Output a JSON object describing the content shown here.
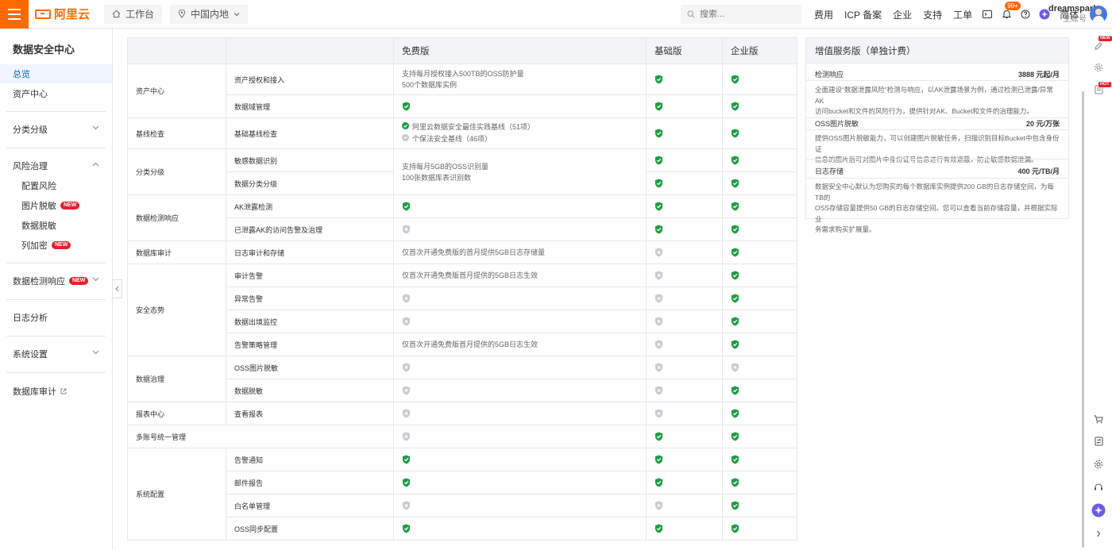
{
  "header": {
    "brand": "阿里云",
    "workbench": "工作台",
    "region": "中国内地",
    "search_placeholder": "搜索...",
    "nav": [
      "费用",
      "ICP 备案",
      "企业",
      "支持",
      "工单"
    ],
    "notification_badge": "99+",
    "lang": "简体",
    "user_name": "dreamspark",
    "user_role": "主账号"
  },
  "sidebar": {
    "title": "数据安全中心",
    "items": [
      {
        "label": "总览"
      },
      {
        "label": "资产中心"
      },
      {
        "label": "分类分级"
      },
      {
        "label": "风险治理"
      },
      {
        "label": "配置风险"
      },
      {
        "label": "图片脱敏",
        "tag": "NEW"
      },
      {
        "label": "数据脱敏"
      },
      {
        "label": "列加密",
        "tag": "NEW"
      },
      {
        "label": "数据检测响应",
        "tag": "NEW"
      },
      {
        "label": "日志分析"
      },
      {
        "label": "系统设置"
      },
      {
        "label": "数据库审计"
      }
    ]
  },
  "table": {
    "headers": [
      "",
      "",
      "免费版",
      "基础版",
      "企业版"
    ],
    "categories": [
      "资产中心",
      "基线检查",
      "分类分级",
      "数据检测响应",
      "数据库审计",
      "安全态势",
      "数据治理",
      "报表中心",
      "多账号统一管理",
      "系统配置"
    ],
    "features": [
      "资产授权和接入",
      "数据域管理",
      "基础基线检查",
      "敏感数据识别",
      "数据分类分级",
      "AK泄露检测",
      "已泄露AK的访问告警及治理",
      "日志审计和存储",
      "审计告警",
      "异常告警",
      "数据出境监控",
      "告警策略管理",
      "OSS图片脱敏",
      "数据脱敏",
      "查看报表",
      "告警通知",
      "邮件报告",
      "白名单管理",
      "OSS同步配置"
    ],
    "free_text": {
      "asset_1": "支持每月授权接入500TB的OSS防护量",
      "asset_2": "500个数据库实例",
      "baseline_1": "阿里云数据安全最佳实践基线（51项）",
      "baseline_2": "个保法安全基线（46项）",
      "classify_1": "支持每月5GB的OSS识别量",
      "classify_2": "100张数据库表识别数",
      "audit_log": "仅首次开通免费版的首月提供5GB日志存储量",
      "audit_alert": "仅首次开通免费版首月提供的5GB日志生效",
      "alert_policy": "仅首次开通免费版首月提供的5GB日志生效"
    }
  },
  "panel": {
    "title": "增值服务版（单独计费）",
    "items": [
      {
        "name": "检测响应",
        "price": "3888 元起/月",
        "desc_1": "全面建设“数据泄露风险”检测与响应，以AK泄露场景为例，通过检测已泄露/异常AK",
        "desc_2": "访问bucket和文件的风险行为，提供针对AK、Bucket和文件的治理能力。"
      },
      {
        "name": "OSS图片脱敏",
        "price": "20 元/万张",
        "desc_1": "提供OSS图片脱敏能力，可以创建图片脱敏任务，扫描识别目标Bucket中包含身份证",
        "desc_2": "信息的图片后可对图片中身份证号信息进行有效遮蔽，防止敏感数据泄漏。"
      },
      {
        "name": "日志存储",
        "price": "400 元/TB/月",
        "desc_1": "数据安全中心默认为您购买的每个数据库实例提供200 GB的日志存储空间，为每TB的",
        "desc_2": "OSS存储容量提供50 GB的日志存储空间。您可以查看当前存储容量，并根据实际业",
        "desc_3": "务需求购买扩展量。"
      }
    ]
  },
  "rail": {
    "tag_new": "NEW",
    "tag_hot": "HOT"
  },
  "colors": {
    "accent": "#ff6a00",
    "check": "#1f9d44",
    "disabled": "#c9cbd0",
    "link": "#0064c8",
    "new_tag": "#e5202e"
  }
}
